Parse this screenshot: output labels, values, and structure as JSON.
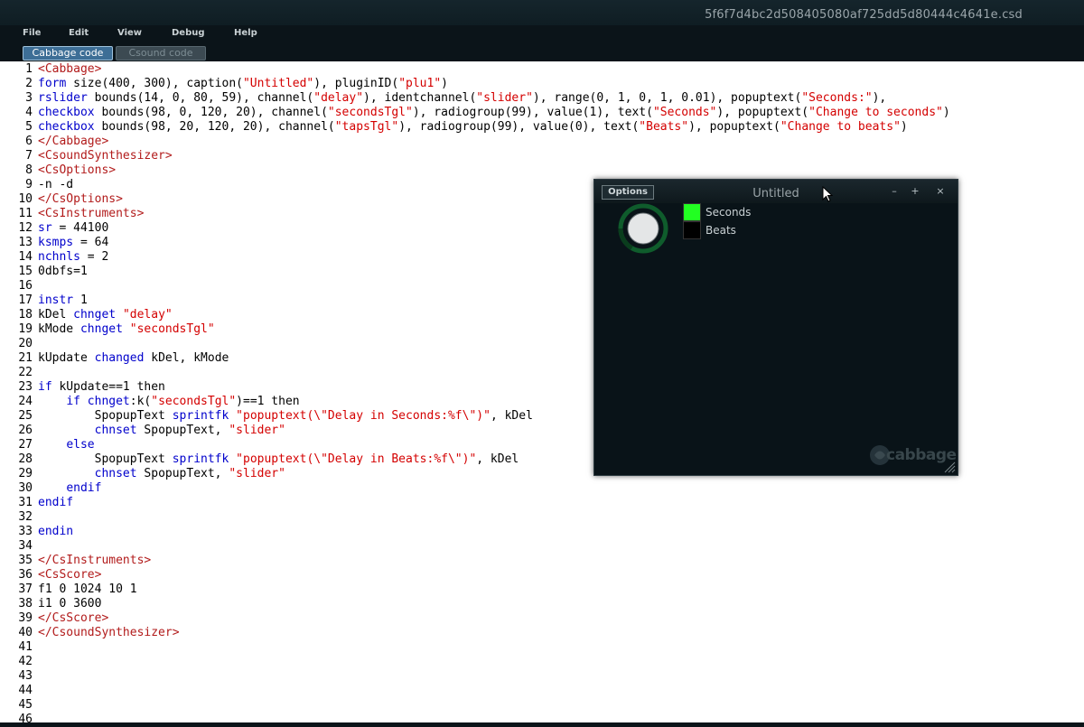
{
  "window": {
    "title": "5f6f7d4bc2d508405080af725dd5d80444c4641e.csd"
  },
  "menu": [
    "File",
    "Edit",
    "View",
    "Debug",
    "Help"
  ],
  "tabs": [
    {
      "label": "Cabbage code",
      "active": true
    },
    {
      "label": "Csound code",
      "active": false
    }
  ],
  "editor": {
    "line_numbers": [
      "1",
      "2",
      "3",
      "4",
      "5",
      "6",
      "7",
      "8",
      "9",
      "10",
      "11",
      "12",
      "13",
      "14",
      "15",
      "16",
      "17",
      "18",
      "19",
      "20",
      "21",
      "22",
      "23",
      "24",
      "25",
      "26",
      "27",
      "28",
      "29",
      "30",
      "31",
      "32",
      "33",
      "34",
      "35",
      "36",
      "37",
      "38",
      "39",
      "40",
      "41",
      "42",
      "43",
      "44",
      "45",
      "46"
    ],
    "lines": [
      [
        [
          "tag",
          "<Cabbage>"
        ]
      ],
      [
        [
          "kw",
          "form"
        ],
        [
          "plain",
          " size(400, 300), caption("
        ],
        [
          "str",
          "\"Untitled\""
        ],
        [
          "plain",
          "), pluginID("
        ],
        [
          "str",
          "\"plu1\""
        ],
        [
          "plain",
          ")"
        ]
      ],
      [
        [
          "kw",
          "rslider"
        ],
        [
          "plain",
          " bounds(14, 0, 80, 59), channel("
        ],
        [
          "str",
          "\"delay\""
        ],
        [
          "plain",
          "), identchannel("
        ],
        [
          "str",
          "\"slider\""
        ],
        [
          "plain",
          "), range(0, 1, 0, 1, 0.01), popuptext("
        ],
        [
          "str",
          "\"Seconds:\""
        ],
        [
          "plain",
          "),"
        ]
      ],
      [
        [
          "kw",
          "checkbox"
        ],
        [
          "plain",
          " bounds(98, 0, 120, 20), channel("
        ],
        [
          "str",
          "\"secondsTgl\""
        ],
        [
          "plain",
          "), radiogroup(99), value(1), text("
        ],
        [
          "str",
          "\"Seconds\""
        ],
        [
          "plain",
          "), popuptext("
        ],
        [
          "str",
          "\"Change to seconds\""
        ],
        [
          "plain",
          ")"
        ]
      ],
      [
        [
          "kw",
          "checkbox"
        ],
        [
          "plain",
          " bounds(98, 20, 120, 20), channel("
        ],
        [
          "str",
          "\"tapsTgl\""
        ],
        [
          "plain",
          "), radiogroup(99), value(0), text("
        ],
        [
          "str",
          "\"Beats\""
        ],
        [
          "plain",
          "), popuptext("
        ],
        [
          "str",
          "\"Change to beats\""
        ],
        [
          "plain",
          ")"
        ]
      ],
      [
        [
          "tag",
          "</Cabbage>"
        ]
      ],
      [
        [
          "tag",
          "<CsoundSynthesizer>"
        ]
      ],
      [
        [
          "tag",
          "<CsOptions>"
        ]
      ],
      [
        [
          "plain",
          "-n -d"
        ]
      ],
      [
        [
          "tag",
          "</CsOptions>"
        ]
      ],
      [
        [
          "tag",
          "<CsInstruments>"
        ]
      ],
      [
        [
          "kw",
          "sr"
        ],
        [
          "plain",
          " = 44100"
        ]
      ],
      [
        [
          "kw",
          "ksmps"
        ],
        [
          "plain",
          " = 64"
        ]
      ],
      [
        [
          "kw",
          "nchnls"
        ],
        [
          "plain",
          " = 2"
        ]
      ],
      [
        [
          "plain",
          "0dbfs=1"
        ]
      ],
      [
        [
          "plain",
          ""
        ]
      ],
      [
        [
          "kw",
          "instr"
        ],
        [
          "plain",
          " 1"
        ]
      ],
      [
        [
          "plain",
          "kDel "
        ],
        [
          "kw",
          "chnget"
        ],
        [
          "plain",
          " "
        ],
        [
          "str",
          "\"delay\""
        ]
      ],
      [
        [
          "plain",
          "kMode "
        ],
        [
          "kw",
          "chnget"
        ],
        [
          "plain",
          " "
        ],
        [
          "str",
          "\"secondsTgl\""
        ]
      ],
      [
        [
          "plain",
          ""
        ]
      ],
      [
        [
          "plain",
          "kUpdate "
        ],
        [
          "kw",
          "changed"
        ],
        [
          "plain",
          " kDel, kMode"
        ]
      ],
      [
        [
          "plain",
          ""
        ]
      ],
      [
        [
          "kw",
          "if"
        ],
        [
          "plain",
          " kUpdate==1 then"
        ]
      ],
      [
        [
          "plain",
          "    "
        ],
        [
          "kw",
          "if"
        ],
        [
          "plain",
          " "
        ],
        [
          "kw",
          "chnget"
        ],
        [
          "plain",
          ":k("
        ],
        [
          "str",
          "\"secondsTgl\""
        ],
        [
          "plain",
          ")==1 then"
        ]
      ],
      [
        [
          "plain",
          "        SpopupText "
        ],
        [
          "kw",
          "sprintfk"
        ],
        [
          "plain",
          " "
        ],
        [
          "str",
          "\"popuptext(\\\"Delay in Seconds:%f\\\")\""
        ],
        [
          "plain",
          ", kDel"
        ]
      ],
      [
        [
          "plain",
          "        "
        ],
        [
          "kw",
          "chnset"
        ],
        [
          "plain",
          " SpopupText, "
        ],
        [
          "str",
          "\"slider\""
        ]
      ],
      [
        [
          "plain",
          "    "
        ],
        [
          "kw",
          "else"
        ]
      ],
      [
        [
          "plain",
          "        SpopupText "
        ],
        [
          "kw",
          "sprintfk"
        ],
        [
          "plain",
          " "
        ],
        [
          "str",
          "\"popuptext(\\\"Delay in Beats:%f\\\")\""
        ],
        [
          "plain",
          ", kDel"
        ]
      ],
      [
        [
          "plain",
          "        "
        ],
        [
          "kw",
          "chnset"
        ],
        [
          "plain",
          " SpopupText, "
        ],
        [
          "str",
          "\"slider\""
        ]
      ],
      [
        [
          "plain",
          "    "
        ],
        [
          "kw",
          "endif"
        ]
      ],
      [
        [
          "kw",
          "endif"
        ]
      ],
      [
        [
          "plain",
          ""
        ]
      ],
      [
        [
          "kw",
          "endin"
        ]
      ],
      [
        [
          "plain",
          ""
        ]
      ],
      [
        [
          "tag",
          "</CsInstruments>"
        ]
      ],
      [
        [
          "tag",
          "<CsScore>"
        ]
      ],
      [
        [
          "plain",
          "f1 0 1024 10 1"
        ]
      ],
      [
        [
          "plain",
          "i1 0 3600"
        ]
      ],
      [
        [
          "tag",
          "</CsScore>"
        ]
      ],
      [
        [
          "tag",
          "</CsoundSynthesizer>"
        ]
      ]
    ]
  },
  "plugin": {
    "options_label": "Options",
    "title": "Untitled",
    "minimize_label": "–",
    "maximize_label": "+",
    "close_label": "×",
    "checkboxes": [
      {
        "label": "Seconds",
        "checked": true,
        "color": "#22ff22"
      },
      {
        "label": "Beats",
        "checked": false,
        "color": "#000000"
      }
    ],
    "slider_value": 0,
    "logo_text": "cabbage"
  },
  "colors": {
    "keyword": "#0000cc",
    "tag": "#b21b1b",
    "string": "#d40000",
    "slider_track": "#0f5c2c",
    "tab_active": "#3d6e96"
  }
}
